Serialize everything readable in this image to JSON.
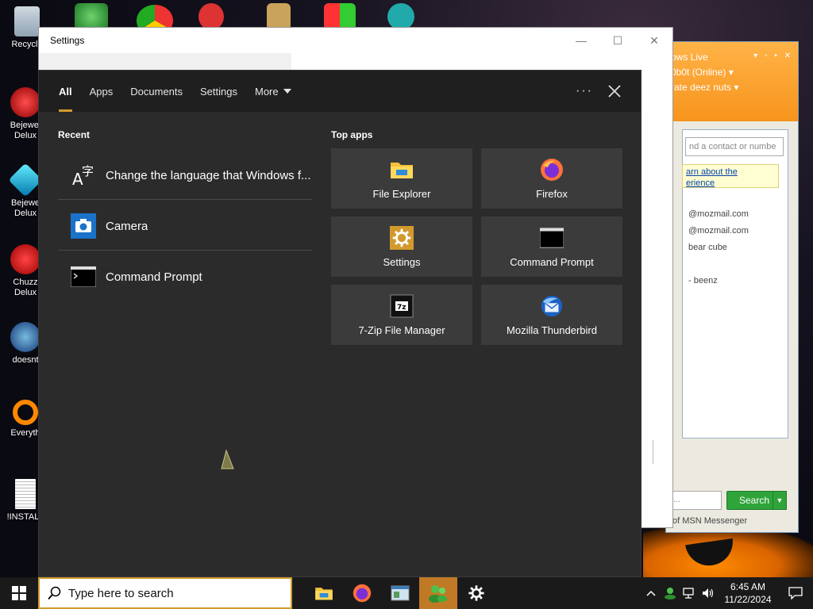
{
  "desktop": {
    "icons": [
      {
        "name": "recycle-bin",
        "label": "Recycle"
      },
      {
        "name": "bejeweled-2",
        "label": "Bejewel Delux"
      },
      {
        "name": "bejeweled-deluxe",
        "label": "Bejewe Delux"
      },
      {
        "name": "chuzzle-deluxe",
        "label": "Chuzz Delux"
      },
      {
        "name": "doesnt",
        "label": "doesnt"
      },
      {
        "name": "everything",
        "label": "Everyth"
      },
      {
        "name": "install",
        "label": "!INSTALL"
      }
    ]
  },
  "settings_window": {
    "title": "Settings",
    "minimize": "—",
    "maximize": "☐",
    "close": "✕"
  },
  "messenger": {
    "header_line1": "ows Live",
    "header_line2": "0b0t  (Online) ▾",
    "header_line3": "rate deez nuts ▾",
    "search_placeholder": "nd a contact or numbe",
    "banner_line1": "arn about the",
    "banner_line2": "erience",
    "contacts": [
      "@mozmail.com",
      "@mozmail.com",
      "bear cube",
      "- beenz"
    ],
    "search_button": "Search",
    "footer": "of MSN Messenger"
  },
  "search_panel": {
    "tabs": [
      {
        "id": "all",
        "label": "All"
      },
      {
        "id": "apps",
        "label": "Apps"
      },
      {
        "id": "documents",
        "label": "Documents"
      },
      {
        "id": "settings",
        "label": "Settings"
      },
      {
        "id": "more",
        "label": "More"
      }
    ],
    "more_options": "···",
    "recent_title": "Recent",
    "recent": [
      {
        "icon": "language-icon",
        "label": "Change the language that Windows f..."
      },
      {
        "icon": "camera-icon",
        "label": "Camera"
      },
      {
        "icon": "command-prompt-icon",
        "label": "Command Prompt"
      }
    ],
    "top_apps_title": "Top apps",
    "top_apps": [
      {
        "icon": "file-explorer-icon",
        "label": "File Explorer"
      },
      {
        "icon": "firefox-icon",
        "label": "Firefox"
      },
      {
        "icon": "settings-icon",
        "label": "Settings"
      },
      {
        "icon": "command-prompt-icon",
        "label": "Command Prompt"
      },
      {
        "icon": "7zip-icon",
        "label": "7-Zip File Manager"
      },
      {
        "icon": "thunderbird-icon",
        "label": "Mozilla Thunderbird"
      }
    ]
  },
  "taskbar": {
    "search_placeholder": "Type here to search",
    "apps": [
      "file-explorer-icon",
      "firefox-icon",
      "network-icon",
      "messenger-icon",
      "settings-icon"
    ],
    "clock_time": "6:45 AM",
    "clock_date": "11/22/2024"
  },
  "colors": {
    "accent": "#d29a2e",
    "panel_bg": "#2b2b2b",
    "tile_bg": "#3b3b3b",
    "taskbar_bg": "#1a1a1a"
  }
}
